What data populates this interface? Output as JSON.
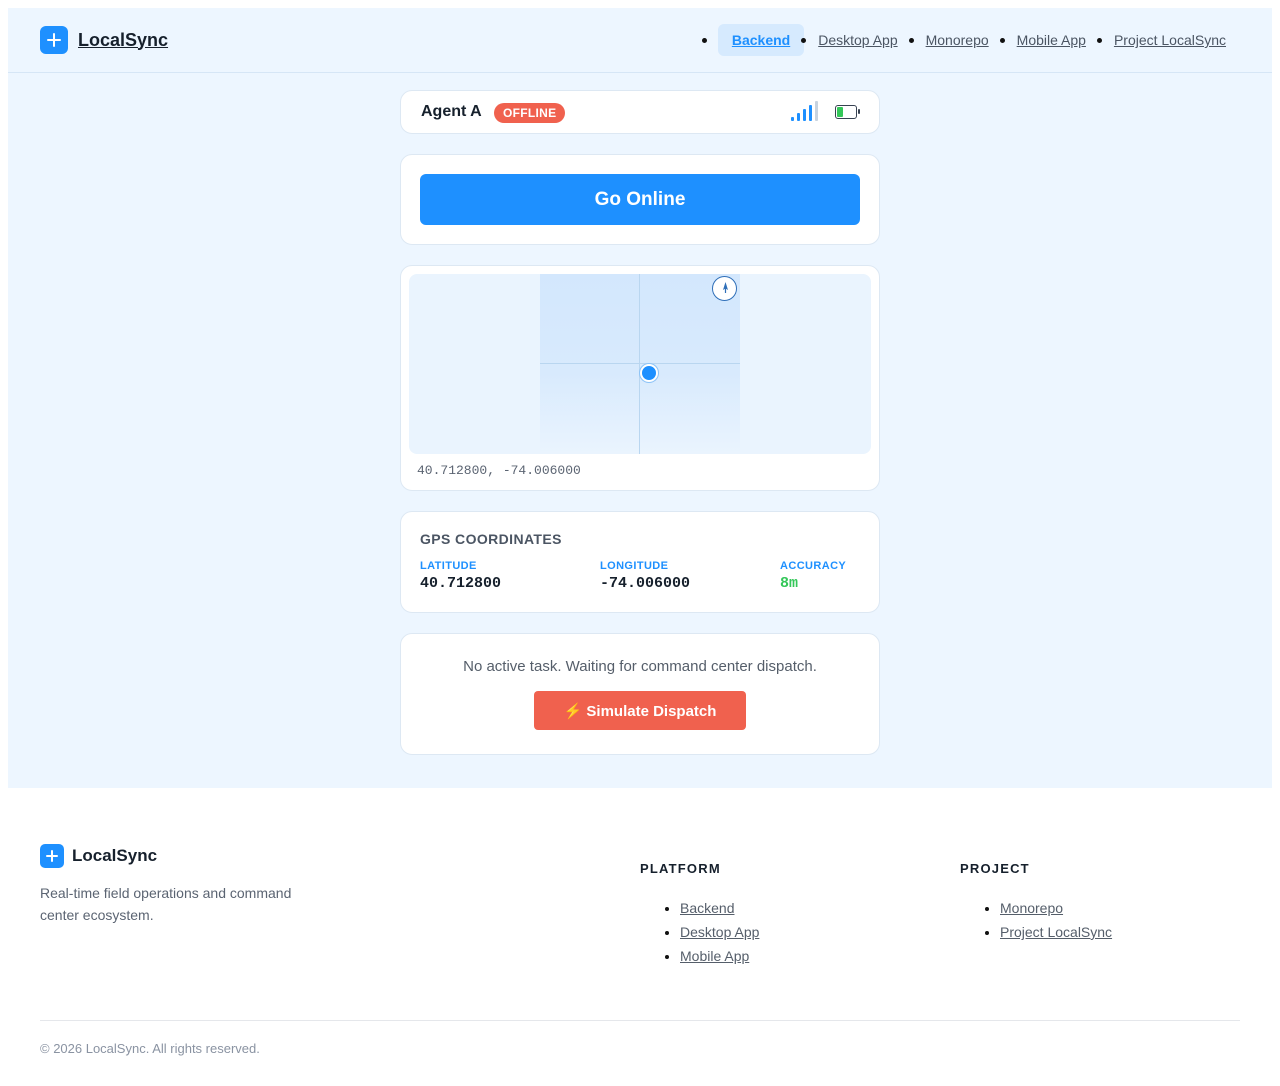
{
  "app": {
    "name": "LocalSync"
  },
  "nav": {
    "items": [
      {
        "label": "Backend",
        "active": true
      },
      {
        "label": "Desktop App"
      },
      {
        "label": "Monorepo"
      },
      {
        "label": "Mobile App"
      },
      {
        "label": "Project LocalSync"
      }
    ]
  },
  "status": {
    "agent_name": "Agent A",
    "connection_badge": "OFFLINE",
    "signal_icon": "signal-bars-icon",
    "battery_icon": "battery-icon",
    "battery_level": 0.4
  },
  "actions": {
    "go_online_label": "Go Online"
  },
  "map": {
    "coordinates_text": "40.712800, -74.006000",
    "compass_icon": "compass-icon",
    "marker_icon": "location-dot-icon"
  },
  "gps": {
    "title": "GPS COORDINATES",
    "latitude_label": "LATITUDE",
    "latitude_value": "40.712800",
    "longitude_label": "LONGITUDE",
    "longitude_value": "-74.006000",
    "accuracy_label": "ACCURACY",
    "accuracy_value": "8m"
  },
  "task": {
    "message": "No active task. Waiting for command center dispatch.",
    "dispatch_label": "⚡ Simulate Dispatch"
  },
  "footer": {
    "brand": "LocalSync",
    "tagline": "Real-time field operations and command center ecosystem.",
    "platform": {
      "title": "PLATFORM",
      "links": [
        "Backend",
        "Desktop App",
        "Mobile App"
      ]
    },
    "project": {
      "title": "PROJECT",
      "links": [
        "Monorepo",
        "Project LocalSync"
      ]
    },
    "copyright": "© 2026 LocalSync. All rights reserved."
  },
  "colors": {
    "accent": "#1e90ff",
    "danger": "#f0614e",
    "success": "#34c759",
    "page_background": "#edf6ff"
  }
}
